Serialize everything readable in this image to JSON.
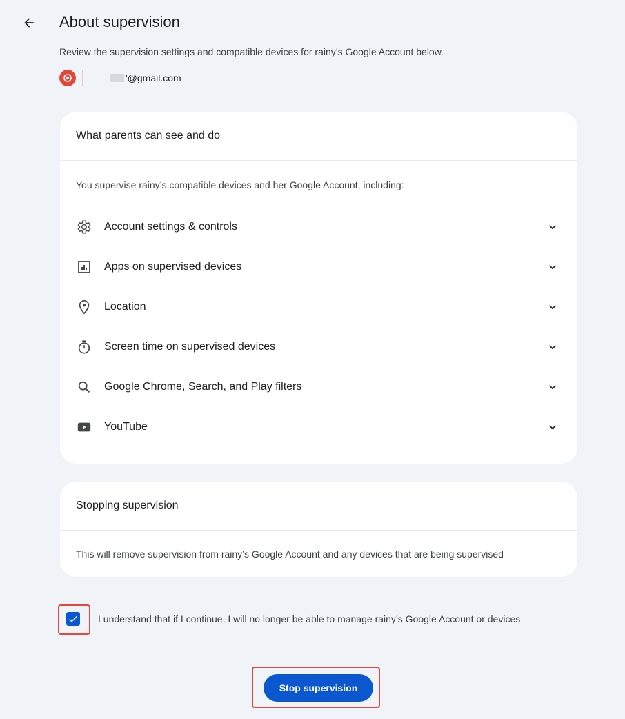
{
  "header": {
    "title": "About supervision",
    "subtitle": "Review the supervision settings and compatible devices for rainy’s Google Account below.",
    "email": "'@gmail.com"
  },
  "card_parents": {
    "heading": "What parents can see and do",
    "intro": "You supervise rainy’s compatible devices and her Google Account, including:",
    "items": [
      {
        "label": "Account settings & controls",
        "icon": "gear-icon"
      },
      {
        "label": "Apps on supervised devices",
        "icon": "apps-chart-icon"
      },
      {
        "label": "Location",
        "icon": "location-pin-icon"
      },
      {
        "label": "Screen time on supervised devices",
        "icon": "timer-icon"
      },
      {
        "label": "Google Chrome, Search, and Play filters",
        "icon": "search-icon"
      },
      {
        "label": "YouTube",
        "icon": "youtube-icon"
      }
    ]
  },
  "card_stopping": {
    "heading": "Stopping supervision",
    "body": "This will remove supervision from rainy’s Google Account and any devices that are being supervised"
  },
  "confirm": {
    "checked": true,
    "label": "I understand that if I continue, I will no longer be able to manage rainy’s Google Account or devices"
  },
  "action": {
    "stop_label": "Stop supervision"
  },
  "colors": {
    "background": "#f0f4f9",
    "primary": "#0b57d0",
    "highlight": "#e4473c",
    "avatar": "#e2483a"
  }
}
